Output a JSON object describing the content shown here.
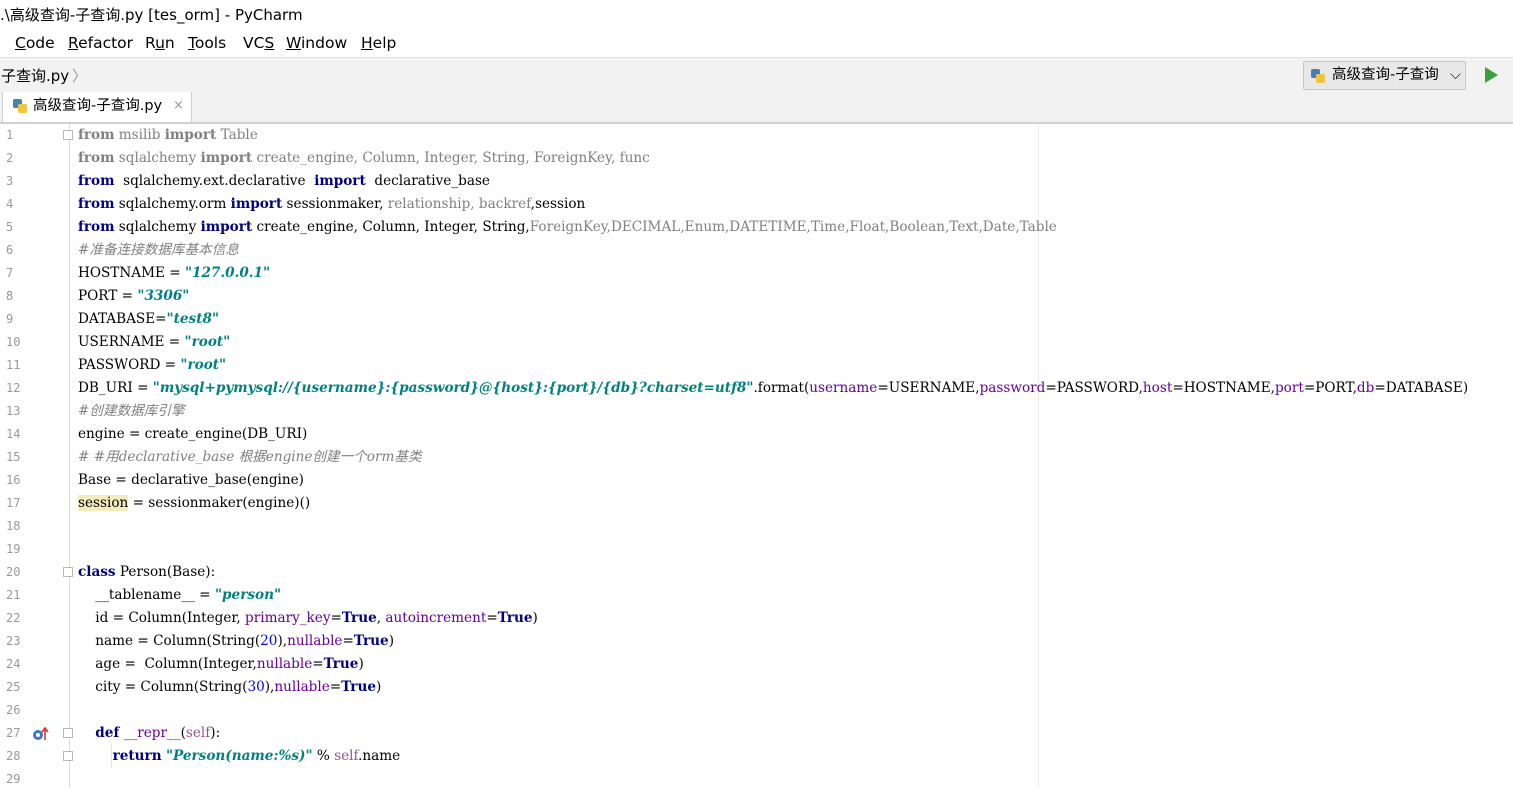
{
  "window": {
    "title": ".\\高级查询-子查询.py [tes_orm] - PyCharm"
  },
  "menu": [
    {
      "mnemonic": "C",
      "rest": "ode"
    },
    {
      "mnemonic": "R",
      "rest": "efactor"
    },
    {
      "pre": "R",
      "mnemonic": "u",
      "rest": "n"
    },
    {
      "mnemonic": "T",
      "rest": "ools"
    },
    {
      "pre": "VC",
      "mnemonic": "S",
      "rest": ""
    },
    {
      "mnemonic": "W",
      "rest": "indow"
    },
    {
      "mnemonic": "H",
      "rest": "elp"
    }
  ],
  "breadcrumb": {
    "file": "子查询.py",
    "separator": "〉"
  },
  "run_config": {
    "label": "高级查询-子查询",
    "chevron": "⌵"
  },
  "tab": {
    "label": "高级查询-子查询.py",
    "close": "×"
  },
  "icons": {
    "python_file": "python-file-icon",
    "run": "run-icon",
    "override": "override-method-icon"
  },
  "colors": {
    "keyword": "#000080",
    "string": "#008080",
    "number": "#0000ff",
    "comment": "#808080",
    "param": "#660099",
    "run_green": "#3c9f3c"
  },
  "editor": {
    "line_numbers": [
      "1",
      "2",
      "3",
      "4",
      "5",
      "6",
      "7",
      "8",
      "9",
      "10",
      "11",
      "12",
      "13",
      "14",
      "15",
      "16",
      "17",
      "18",
      "19",
      "20",
      "21",
      "22",
      "23",
      "24",
      "25",
      "26",
      "27",
      "28",
      "29"
    ],
    "lines": [
      [
        [
          "kw-g",
          "from"
        ],
        [
          "gry",
          " msilib "
        ],
        [
          "kw-g",
          "import"
        ],
        [
          "gry",
          " Table"
        ]
      ],
      [
        [
          "kw-g",
          "from"
        ],
        [
          "gry",
          " sqlalchemy "
        ],
        [
          "kw-g",
          "import"
        ],
        [
          "gry",
          " create_engine, Column, Integer, String, ForeignKey, func"
        ]
      ],
      [
        [
          "kw",
          "from"
        ],
        [
          "t",
          "  sqlalchemy.ext.declarative  "
        ],
        [
          "kw",
          "import"
        ],
        [
          "t",
          "  declarative_base"
        ]
      ],
      [
        [
          "kw",
          "from"
        ],
        [
          "t",
          " sqlalchemy.orm "
        ],
        [
          "kw",
          "import"
        ],
        [
          "t",
          " sessionmaker, "
        ],
        [
          "gry",
          "relationship, backref"
        ],
        [
          "t",
          ",session"
        ]
      ],
      [
        [
          "kw",
          "from"
        ],
        [
          "t",
          " sqlalchemy "
        ],
        [
          "kw",
          "import"
        ],
        [
          "t",
          " create_engine, Column, Integer, String,"
        ],
        [
          "gry",
          "ForeignKey,DECIMAL,Enum,DATETIME,Time,Float,Boolean,Text,Date,Table"
        ]
      ],
      [
        [
          "cm",
          "#准备连接数据库基本信息"
        ]
      ],
      [
        [
          "t",
          "HOSTNAME = "
        ],
        [
          "str",
          "\"127.0.0.1\""
        ]
      ],
      [
        [
          "t",
          "PORT = "
        ],
        [
          "str",
          "\"3306\""
        ]
      ],
      [
        [
          "t",
          "DATABASE="
        ],
        [
          "str",
          "\"test8\""
        ]
      ],
      [
        [
          "t",
          "USERNAME = "
        ],
        [
          "str",
          "\"root\""
        ]
      ],
      [
        [
          "t",
          "PASSWORD = "
        ],
        [
          "str",
          "\"root\""
        ]
      ],
      [
        [
          "t",
          "DB_URI = "
        ],
        [
          "str",
          "\"mysql+pymysql://{username}:{password}@{host}:{port}/{db}?charset=utf8\""
        ],
        [
          "t",
          ".format("
        ],
        [
          "par",
          "username"
        ],
        [
          "t",
          "=USERNAME,"
        ],
        [
          "par",
          "password"
        ],
        [
          "t",
          "=PASSWORD,"
        ],
        [
          "par",
          "host"
        ],
        [
          "t",
          "=HOSTNAME,"
        ],
        [
          "par",
          "port"
        ],
        [
          "t",
          "=PORT,"
        ],
        [
          "par",
          "db"
        ],
        [
          "t",
          "=DATABASE)"
        ]
      ],
      [
        [
          "cm",
          "#创建数据库引擎"
        ]
      ],
      [
        [
          "t",
          "engine = create_engine(DB_URI)"
        ]
      ],
      [
        [
          "cm",
          "# #用declarative_base 根据engine创建一个orm基类"
        ]
      ],
      [
        [
          "t",
          "Base = declarative_base(engine)"
        ]
      ],
      [
        [
          "hl",
          "session"
        ],
        [
          "t",
          " = sessionmaker(engine)()"
        ]
      ],
      [],
      [],
      [
        [
          "kw",
          "class"
        ],
        [
          "t",
          " Person(Base):"
        ]
      ],
      [
        [
          "t",
          "    __tablename__ = "
        ],
        [
          "str",
          "\"person\""
        ]
      ],
      [
        [
          "t",
          "    id = Column(Integer, "
        ],
        [
          "par",
          "primary_key"
        ],
        [
          "t",
          "="
        ],
        [
          "kw",
          "True"
        ],
        [
          "t",
          ", "
        ],
        [
          "par",
          "autoincrement"
        ],
        [
          "t",
          "="
        ],
        [
          "kw",
          "True"
        ],
        [
          "t",
          ")"
        ]
      ],
      [
        [
          "t",
          "    name = Column(String("
        ],
        [
          "num",
          "20"
        ],
        [
          "t",
          "),"
        ],
        [
          "par",
          "nullable"
        ],
        [
          "t",
          "="
        ],
        [
          "kw",
          "True"
        ],
        [
          "t",
          ")"
        ]
      ],
      [
        [
          "t",
          "    age =  Column(Integer,"
        ],
        [
          "par",
          "nullable"
        ],
        [
          "t",
          "="
        ],
        [
          "kw",
          "True"
        ],
        [
          "t",
          ")"
        ]
      ],
      [
        [
          "t",
          "    city = Column(String("
        ],
        [
          "num",
          "30"
        ],
        [
          "t",
          "),"
        ],
        [
          "par",
          "nullable"
        ],
        [
          "t",
          "="
        ],
        [
          "kw",
          "True"
        ],
        [
          "t",
          ")"
        ]
      ],
      [],
      [
        [
          "t",
          "    "
        ],
        [
          "kw",
          "def"
        ],
        [
          "t",
          " "
        ],
        [
          "par",
          "__repr__"
        ],
        [
          "t",
          "("
        ],
        [
          "selfk",
          "self"
        ],
        [
          "t",
          "):"
        ]
      ],
      [
        [
          "t",
          "        "
        ],
        [
          "kw",
          "return"
        ],
        [
          "t",
          " "
        ],
        [
          "str",
          "\"Person(name:%s)\""
        ],
        [
          "t",
          " % "
        ],
        [
          "selfk",
          "self"
        ],
        [
          "t",
          ".name"
        ]
      ],
      []
    ],
    "fold_lines": [
      1,
      20,
      27,
      28
    ],
    "override_line": 27
  }
}
